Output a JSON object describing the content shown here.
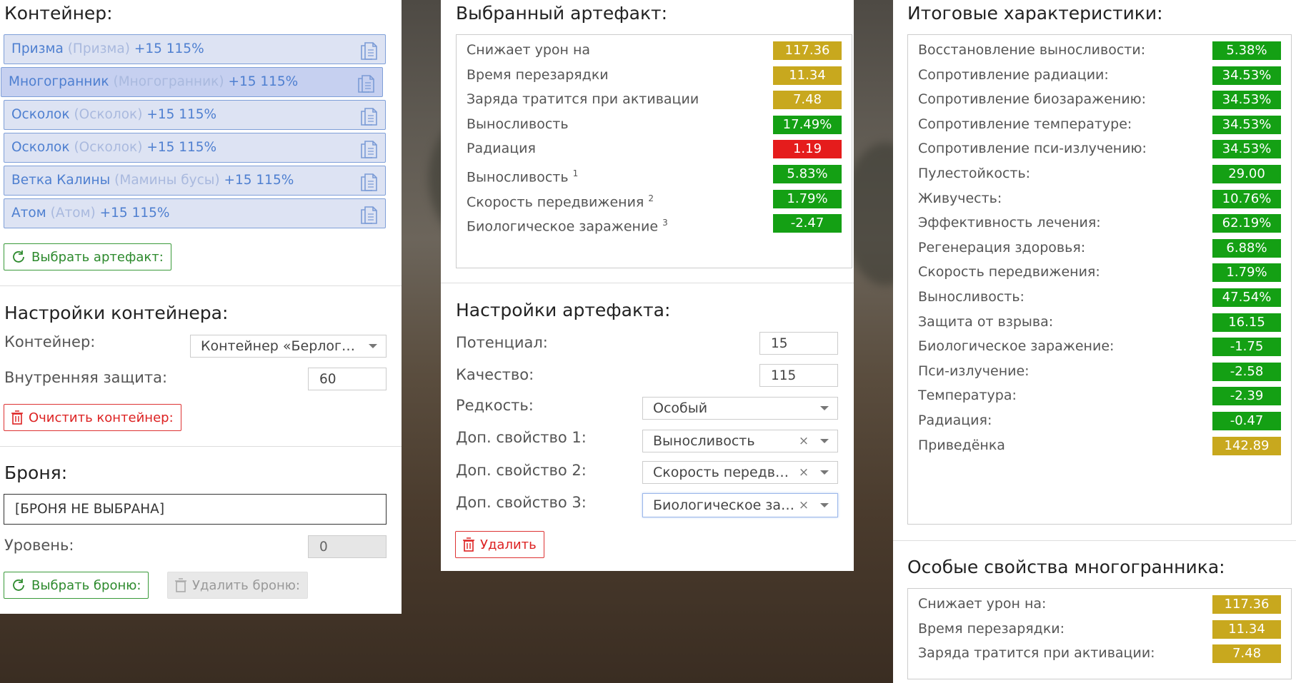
{
  "colors": {
    "yellow": "#c8a81e",
    "green": "#14a014",
    "red": "#e51c1c",
    "item_blue": "#4e7fd0"
  },
  "container": {
    "title": "Контейнер:",
    "items": [
      {
        "name": "Призма",
        "alt": "(Призма)",
        "bonus": "+15 115%"
      },
      {
        "name": "Многогранник",
        "alt": "(Многогранник)",
        "bonus": "+15 115%"
      },
      {
        "name": "Осколок",
        "alt": "(Осколок)",
        "bonus": "+15 115%"
      },
      {
        "name": "Осколок",
        "alt": "(Осколок)",
        "bonus": "+15 115%"
      },
      {
        "name": "Ветка Калины",
        "alt": "(Мамины бусы)",
        "bonus": "+15 115%"
      },
      {
        "name": "Атом",
        "alt": "(Атом)",
        "bonus": "+15 115%"
      }
    ],
    "select_button": "Выбрать артефакт:",
    "settings_title": "Настройки контейнера:",
    "container_label": "Контейнер:",
    "container_value": "Контейнер «Берлога...",
    "protection_label": "Внутренняя защита:",
    "protection_value": "60",
    "clear_button": "Очистить контейнер:"
  },
  "armor": {
    "title": "Броня:",
    "value": "[БРОНЯ НЕ ВЫБРАНА]",
    "level_label": "Уровень:",
    "level_value": "0",
    "select_button": "Выбрать броню:",
    "delete_button": "Удалить броню:"
  },
  "artifact": {
    "title": "Выбранный артефакт:",
    "stats": [
      {
        "name": "Снижает урон на",
        "sup": "",
        "value": "117.36",
        "color": "yellow"
      },
      {
        "name": "Время перезарядки",
        "sup": "",
        "value": "11.34",
        "color": "yellow"
      },
      {
        "name": "Заряда тратится при активации",
        "sup": "",
        "value": "7.48",
        "color": "yellow"
      },
      {
        "name": "Выносливость",
        "sup": "",
        "value": "17.49%",
        "color": "green"
      },
      {
        "name": "Радиация",
        "sup": "",
        "value": "1.19",
        "color": "red"
      },
      {
        "name": "Выносливость",
        "sup": "1",
        "value": "5.83%",
        "color": "green"
      },
      {
        "name": "Скорость передвижения",
        "sup": "2",
        "value": "1.79%",
        "color": "green"
      },
      {
        "name": "Биологическое заражение",
        "sup": "3",
        "value": "-2.47",
        "color": "green"
      }
    ],
    "settings_title": "Настройки артефакта:",
    "potential_label": "Потенциал:",
    "potential_value": "15",
    "quality_label": "Качество:",
    "quality_value": "115",
    "rarity_label": "Редкость:",
    "rarity_value": "Особый",
    "prop1_label": "Доп. свойство 1:",
    "prop1_value": "Выносливость",
    "prop2_label": "Доп. свойство 2:",
    "prop2_value": "Скорость передвижения",
    "prop3_label": "Доп. свойство 3:",
    "prop3_value": "Биологическое заражение",
    "clear_x": "×",
    "delete_button": "Удалить"
  },
  "totals": {
    "title": "Итоговые характеристики:",
    "stats": [
      {
        "name": "Восстановление выносливости:",
        "value": "5.38%",
        "color": "green"
      },
      {
        "name": "Сопротивление радиации:",
        "value": "34.53%",
        "color": "green"
      },
      {
        "name": "Сопротивление биозаражению:",
        "value": "34.53%",
        "color": "green"
      },
      {
        "name": "Сопротивление температуре:",
        "value": "34.53%",
        "color": "green"
      },
      {
        "name": "Сопротивление пси-излучению:",
        "value": "34.53%",
        "color": "green"
      },
      {
        "name": "Пулестойкость:",
        "value": "29.00",
        "color": "green"
      },
      {
        "name": "Живучесть:",
        "value": "10.76%",
        "color": "green"
      },
      {
        "name": "Эффективность лечения:",
        "value": "62.19%",
        "color": "green"
      },
      {
        "name": "Регенерация здоровья:",
        "value": "6.88%",
        "color": "green"
      },
      {
        "name": "Скорость передвижения:",
        "value": "1.79%",
        "color": "green"
      },
      {
        "name": "Выносливость:",
        "value": "47.54%",
        "color": "green"
      },
      {
        "name": "Защита от взрыва:",
        "value": "16.15",
        "color": "green"
      },
      {
        "name": "Биологическое заражение:",
        "value": "-1.75",
        "color": "green"
      },
      {
        "name": "Пси-излучение:",
        "value": "-2.58",
        "color": "green"
      },
      {
        "name": "Температура:",
        "value": "-2.39",
        "color": "green"
      },
      {
        "name": "Радиация:",
        "value": "-0.47",
        "color": "green"
      },
      {
        "name": "Приведёнка",
        "value": "142.89",
        "color": "yellow"
      }
    ]
  },
  "special": {
    "title": "Особые свойства многогранника:",
    "stats": [
      {
        "name": "Снижает урон на:",
        "value": "117.36",
        "color": "yellow"
      },
      {
        "name": "Время перезарядки:",
        "value": "11.34",
        "color": "yellow"
      },
      {
        "name": "Заряда тратится при активации:",
        "value": "7.48",
        "color": "yellow"
      }
    ]
  }
}
